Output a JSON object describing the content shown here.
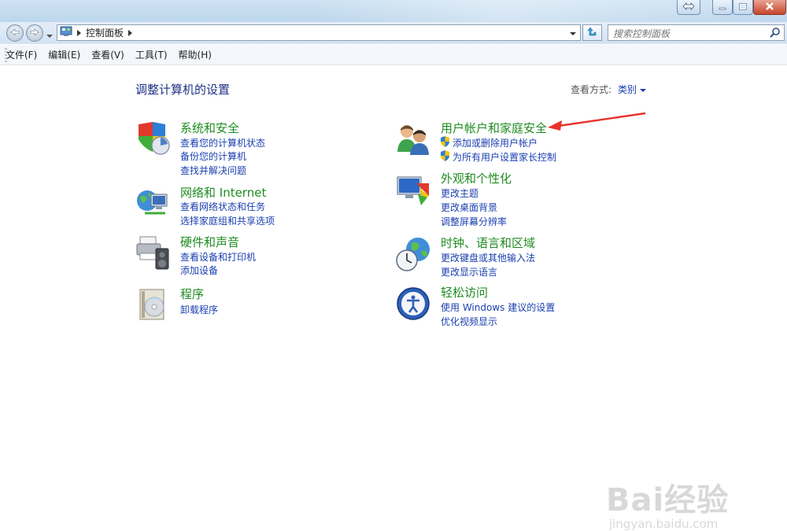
{
  "window": {
    "controls": [
      "restore-icon",
      "minimize-icon",
      "maximize-icon",
      "close-icon"
    ]
  },
  "address": {
    "crumb": "控制面板",
    "search_placeholder": "搜索控制面板"
  },
  "menu": {
    "items": [
      "文件(F)",
      "编辑(E)",
      "查看(V)",
      "工具(T)",
      "帮助(H)"
    ]
  },
  "main": {
    "title": "调整计算机的设置",
    "view_label": "查看方式:",
    "view_value": "类别"
  },
  "categories": [
    {
      "title": "系统和安全",
      "icon": "shield-chart-icon",
      "links": [
        "查看您的计算机状态",
        "备份您的计算机",
        "查找并解决问题"
      ]
    },
    {
      "title": "网络和 Internet",
      "icon": "globe-network-icon",
      "links": [
        "查看网络状态和任务",
        "选择家庭组和共享选项"
      ]
    },
    {
      "title": "硬件和声音",
      "icon": "printer-speaker-icon",
      "links": [
        "查看设备和打印机",
        "添加设备"
      ]
    },
    {
      "title": "程序",
      "icon": "programs-disc-icon",
      "links": [
        "卸载程序"
      ]
    },
    {
      "title": "用户帐户和家庭安全",
      "icon": "users-icon",
      "links": [
        "添加或删除用户帐户",
        "为所有用户设置家长控制"
      ]
    },
    {
      "title": "外观和个性化",
      "icon": "monitor-palette-icon",
      "links": [
        "更改主题",
        "更改桌面背景",
        "调整屏幕分辨率"
      ]
    },
    {
      "title": "时钟、语言和区域",
      "icon": "clock-globe-icon",
      "links": [
        "更改键盘或其他输入法",
        "更改显示语言"
      ]
    },
    {
      "title": "轻松访问",
      "icon": "ease-of-access-icon",
      "links": [
        "使用 Windows 建议的设置",
        "优化视频显示"
      ]
    }
  ],
  "watermark": {
    "brand": "Bai经验",
    "url": "jingyan.baidu.com"
  },
  "colors": {
    "category_title": "#1e8b20",
    "link": "#1a3fb0",
    "page_title": "#1e3287",
    "annotation_arrow": "#e8322d"
  }
}
